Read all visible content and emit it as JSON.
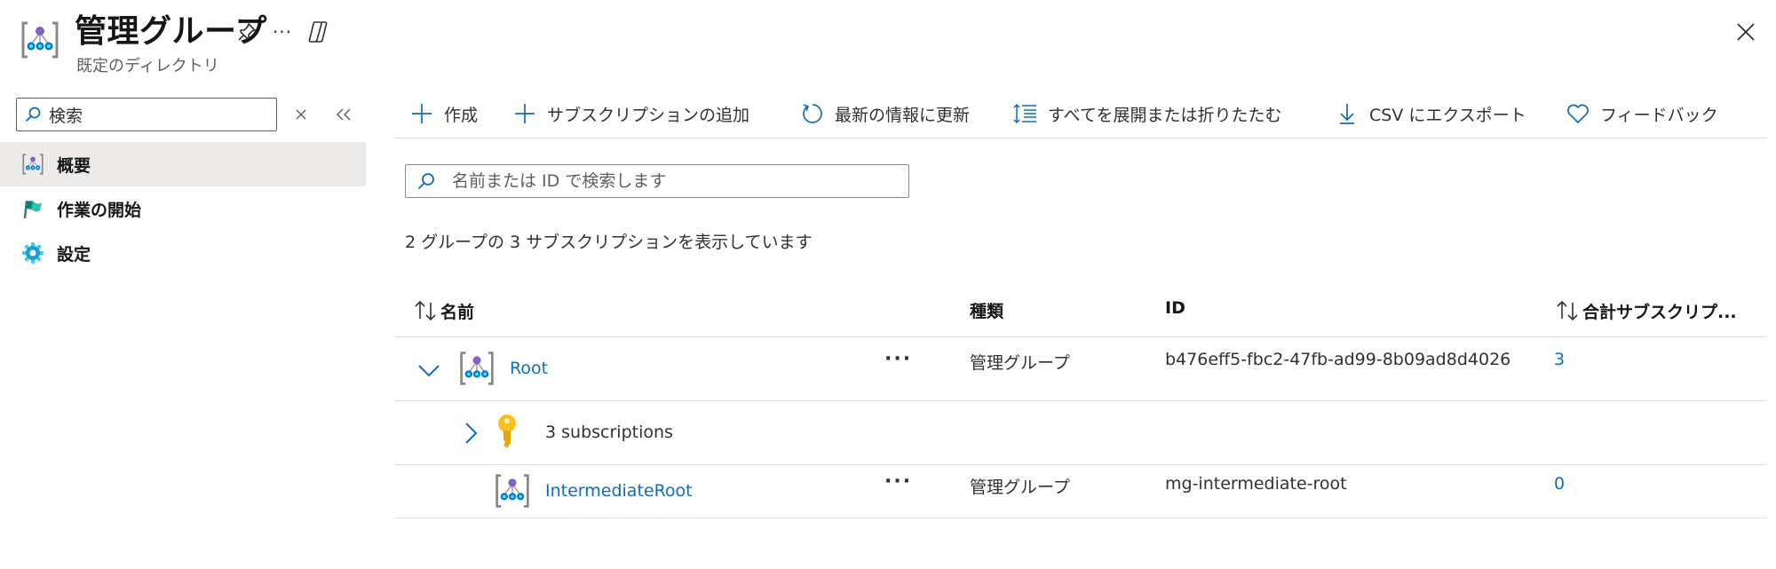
{
  "header": {
    "title": "管理グループ",
    "subtitle": "既定のディレクトリ",
    "icons": {
      "title": "management-group-icon",
      "pin": "pin-icon",
      "more": "more-icon",
      "copilot": "copilot-icon",
      "close": "close-icon"
    },
    "more_label": "···"
  },
  "sidebar": {
    "search": {
      "value": "検索",
      "placeholder": ""
    },
    "items": [
      {
        "label": "概要",
        "icon": "management-group-icon",
        "active": true
      },
      {
        "label": "作業の開始",
        "icon": "flag-icon",
        "active": false
      },
      {
        "label": "設定",
        "icon": "gear-icon",
        "active": false
      }
    ]
  },
  "toolbar": {
    "items": [
      {
        "label": "作成",
        "icon": "plus-icon"
      },
      {
        "label": "サブスクリプションの追加",
        "icon": "plus-icon"
      },
      {
        "label": "最新の情報に更新",
        "icon": "refresh-icon"
      },
      {
        "label": "すべてを展開または折りたたむ",
        "icon": "expand-collapse-icon"
      },
      {
        "label": "CSV にエクスポート",
        "icon": "download-icon"
      },
      {
        "label": "フィードバック",
        "icon": "heart-icon"
      }
    ]
  },
  "main": {
    "search_placeholder": "名前または ID で検索します",
    "summary": "2 グループの 3 サブスクリプションを表示しています",
    "columns": {
      "name": "名前",
      "type": "種類",
      "id": "ID",
      "total": "合計サブスクリプ..."
    },
    "rows": [
      {
        "name": "Root",
        "type": "管理グループ",
        "id": "b476eff5-fbc2-47fb-ad99-8b09ad8d4026",
        "total": "3",
        "more": "···"
      },
      {
        "name": "3 subscriptions"
      },
      {
        "name": "IntermediateRoot",
        "type": "管理グループ",
        "id": "mg-intermediate-root",
        "total": "0",
        "more": "···"
      }
    ]
  },
  "colors": {
    "accent": "#0f6cbd",
    "nav_active_bg": "#edebe9",
    "border": "#e1dfdd",
    "key_yellow": "#f8c21b"
  }
}
